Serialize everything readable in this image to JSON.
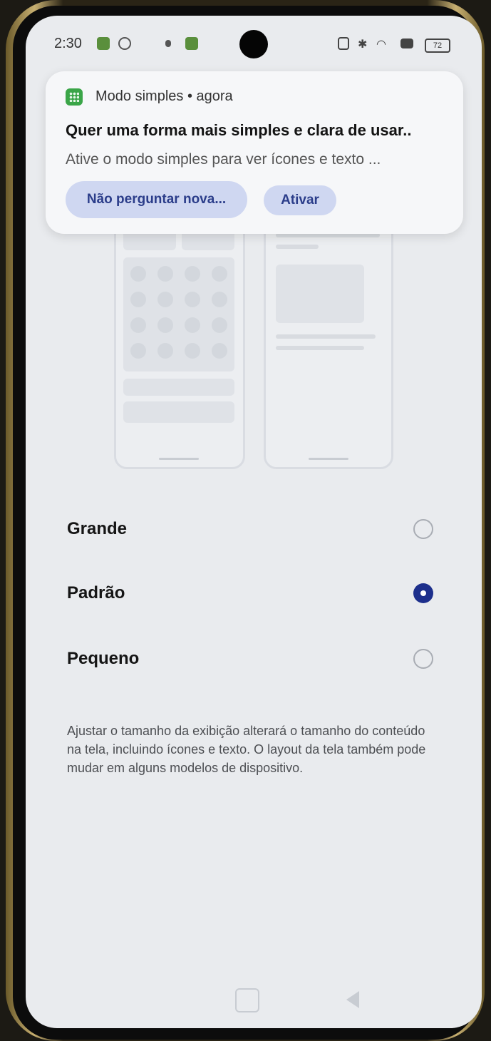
{
  "status_bar": {
    "time": "2:30",
    "battery": "72"
  },
  "notification": {
    "app_name": "Modo simples",
    "time_label": "agora",
    "title": "Quer uma forma mais simples e clara de usar..",
    "body": "Ative o modo simples para ver ícones e texto ...",
    "dismiss_label": "Não perguntar nova...",
    "activate_label": "Ativar"
  },
  "size_options": [
    {
      "label": "Grande",
      "selected": false
    },
    {
      "label": "Padrão",
      "selected": true
    },
    {
      "label": "Pequeno",
      "selected": false
    }
  ],
  "description": "Ajustar o tamanho da exibição alterará o tamanho do conteúdo na tela, incluindo ícones e texto. O layout da tela também pode mudar em alguns modelos de dispositivo.",
  "colors": {
    "accent": "#1d2f8c",
    "button_bg": "#cfd7f1",
    "app_icon": "#3aa548"
  }
}
